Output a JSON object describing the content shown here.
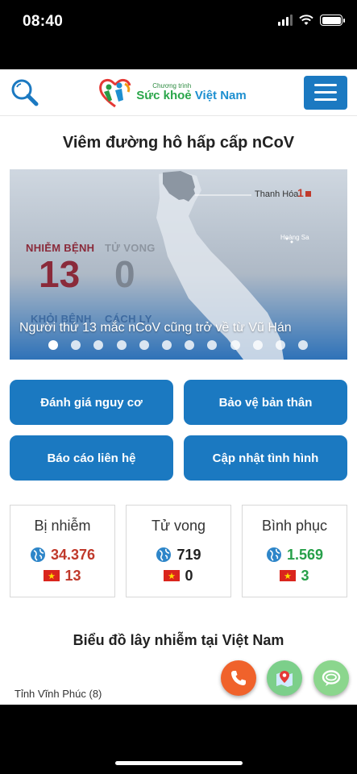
{
  "status_bar": {
    "time": "08:40"
  },
  "header": {
    "brand_small": "Chương trình",
    "brand_part1": "Sức khoẻ",
    "brand_part2": "Việt Nam"
  },
  "page_title": "Viêm đường hô hấp cấp nCoV",
  "banner": {
    "map_label": "Thanh Hóa",
    "map_count": "1",
    "island_label": "Hoàng Sa",
    "infected_label": "NHIỄM BỆNH",
    "infected_value": "13",
    "deaths_label": "TỬ VONG",
    "deaths_value": "0",
    "recovered_label": "KHỎI BỆNH",
    "isolation_label": "CÁCH LY",
    "caption": "Người thứ 13 mắc nCoV cũng trở về từ Vũ Hán",
    "slide_count": 12,
    "active_slide": 0
  },
  "actions": {
    "assess_risk": "Đánh giá nguy cơ",
    "protect_self": "Bảo vệ bản thân",
    "report_contact": "Báo cáo liên hệ",
    "update_situation": "Cập nhật tình hình"
  },
  "stats": {
    "infected": {
      "label": "Bị nhiễm",
      "world": "34.376",
      "vn": "13",
      "color": "#c0392b"
    },
    "deaths": {
      "label": "Tử vong",
      "world": "719",
      "vn": "0",
      "color": "#222222"
    },
    "recovered": {
      "label": "Bình phục",
      "world": "1.569",
      "vn": "3",
      "color": "#27a04a"
    }
  },
  "chart": {
    "title": "Biểu đồ lây nhiễm tại Việt Nam",
    "first_province": "Tỉnh Vĩnh Phúc (8)"
  },
  "colors": {
    "primary": "#1b79c1",
    "fab_phone": "#f0622b",
    "fab_map": "#7ccf8a",
    "fab_chat": "#8bd68d"
  }
}
